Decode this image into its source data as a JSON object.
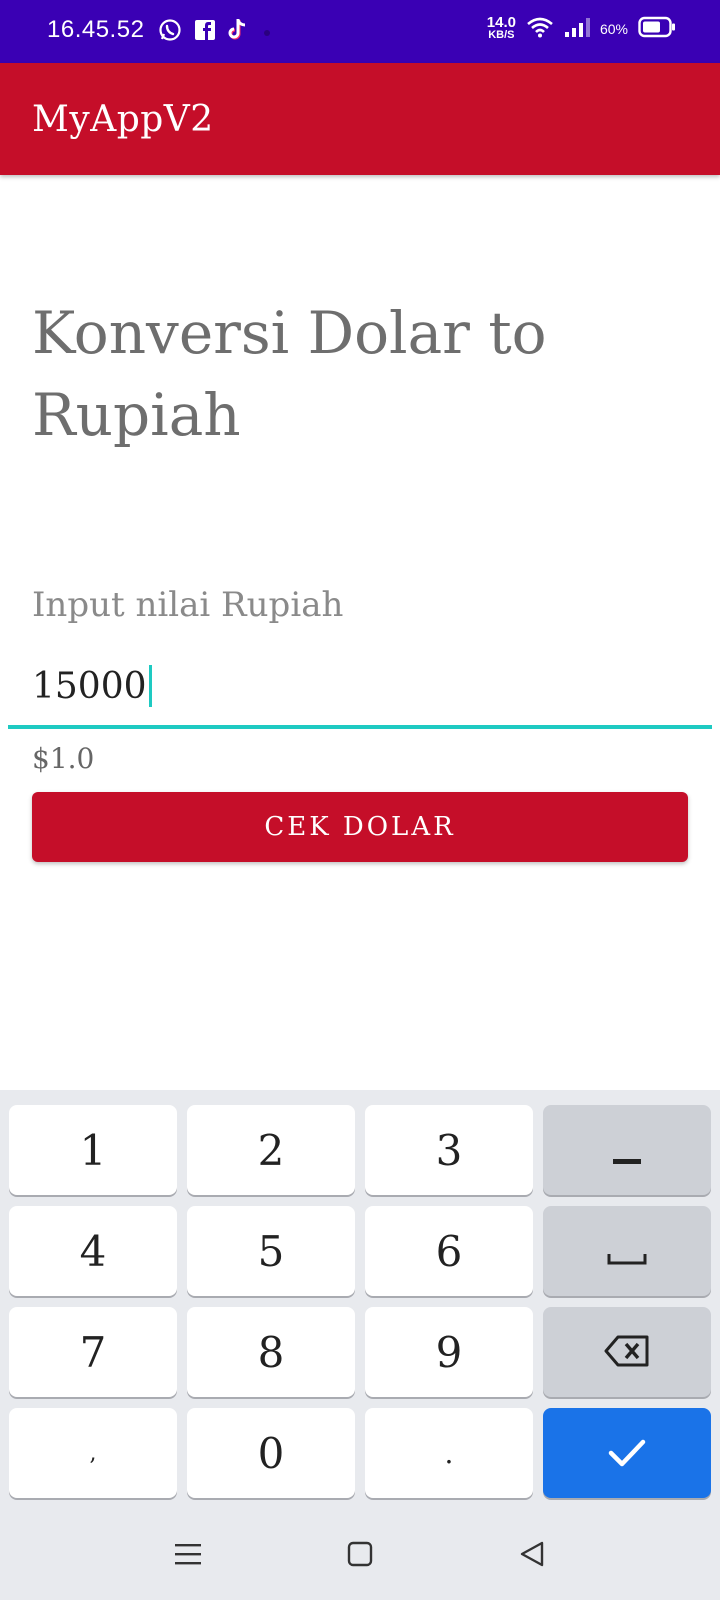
{
  "status_bar": {
    "time": "16.45.52",
    "net_speed_value": "14.0",
    "net_speed_unit": "KB/S",
    "battery": "60%",
    "icons": [
      "whatsapp-icon",
      "facebook-icon",
      "tiktok-icon",
      "wifi-icon",
      "signal-icon",
      "battery-icon"
    ]
  },
  "app_bar": {
    "title": "MyAppV2"
  },
  "main": {
    "heading": "Konversi Dolar to Rupiah",
    "input_label": "Input nilai Rupiah",
    "input_value": "15000",
    "result": "$1.0",
    "button_label": "CEK DOLAR"
  },
  "keyboard": {
    "keys": [
      {
        "label": "1"
      },
      {
        "label": "2"
      },
      {
        "label": "3"
      },
      {
        "label": "−"
      },
      {
        "label": "4"
      },
      {
        "label": "5"
      },
      {
        "label": "6"
      },
      {
        "label": "space",
        "icon": "space-icon"
      },
      {
        "label": "7"
      },
      {
        "label": "8"
      },
      {
        "label": "9"
      },
      {
        "label": "backspace",
        "icon": "backspace-icon"
      },
      {
        "label": ","
      },
      {
        "label": "0"
      },
      {
        "label": "."
      },
      {
        "label": "done",
        "icon": "check-icon"
      }
    ]
  },
  "colors": {
    "status_bar": "#3a00b4",
    "primary": "#c50e29",
    "accent": "#1ecac2",
    "done_key": "#1a73e8"
  },
  "nav_bar": {
    "icons": [
      "menu-icon",
      "home-icon",
      "back-icon"
    ]
  }
}
